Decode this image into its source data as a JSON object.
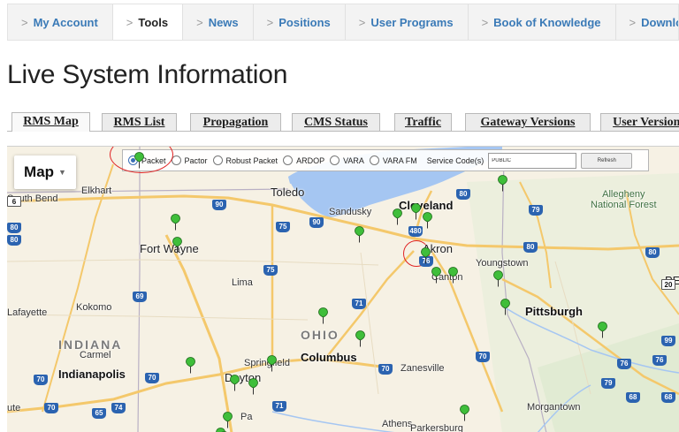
{
  "nav": {
    "items": [
      {
        "label": "My Account",
        "active": false
      },
      {
        "label": "Tools",
        "active": true
      },
      {
        "label": "News",
        "active": false
      },
      {
        "label": "Positions",
        "active": false
      },
      {
        "label": "User Programs",
        "active": false
      },
      {
        "label": "Book of Knowledge",
        "active": false
      },
      {
        "label": "Download",
        "active": false
      }
    ]
  },
  "page": {
    "title": "Live System Information"
  },
  "tabs": [
    {
      "label": "RMS Map",
      "active": true
    },
    {
      "label": "RMS List",
      "active": false
    },
    {
      "label": "Propagation",
      "active": false
    },
    {
      "label": "CMS Status",
      "active": false
    },
    {
      "label": "Traffic",
      "active": false
    },
    {
      "label": "Gateway Versions",
      "active": false
    },
    {
      "label": "User Versions",
      "active": false
    }
  ],
  "map": {
    "type_button": "Map",
    "filter": {
      "options": [
        {
          "label": "Packet",
          "checked": true
        },
        {
          "label": "Pactor",
          "checked": false
        },
        {
          "label": "Robust Packet",
          "checked": false
        },
        {
          "label": "ARDOP",
          "checked": false
        },
        {
          "label": "VARA",
          "checked": false
        },
        {
          "label": "VARA FM",
          "checked": false
        }
      ],
      "service_label": "Service Code(s)",
      "service_value": "PUBLIC",
      "refresh_label": "Refresh"
    },
    "places": {
      "south_bend": "South Bend",
      "elkhart": "Elkhart",
      "toledo": "Toledo",
      "sandusky": "Sandusky",
      "cleveland": "Cleveland",
      "allegheny": "Allegheny",
      "national_forest": "National Forest",
      "fort_wayne": "Fort Wayne",
      "akron": "Akron",
      "youngstown": "Youngstown",
      "lima": "Lima",
      "canton": "Canton",
      "lafayette": "Lafayette",
      "kokomo": "Kokomo",
      "pittsburgh": "Pittsburgh",
      "indiana": "INDIANA",
      "ohio": "OHIO",
      "carmel": "Carmel",
      "columbus": "Columbus",
      "springfield": "Springfield",
      "indianapolis": "Indianapolis",
      "dayton": "Dayton",
      "zanesville": "Zanesville",
      "ute": "ute",
      "morgantown": "Morgantown",
      "athens": "Athens",
      "parkersburg": "Parkersburg",
      "pe": "PE",
      "pa": "Pa"
    },
    "shields": [
      "90",
      "75",
      "90",
      "80",
      "79",
      "75",
      "69",
      "480",
      "80",
      "76",
      "80",
      "71",
      "80",
      "70",
      "70",
      "70",
      "65",
      "74",
      "71",
      "79",
      "76",
      "76",
      "68",
      "68",
      "99",
      "70",
      "6",
      "20",
      "80",
      "70"
    ],
    "colors": {
      "pin": "#3fbe3a",
      "lake": "#a5c6f2",
      "highway": "#f4c86b",
      "highlight": "#e02424",
      "accent": "#3a7ab7"
    }
  }
}
